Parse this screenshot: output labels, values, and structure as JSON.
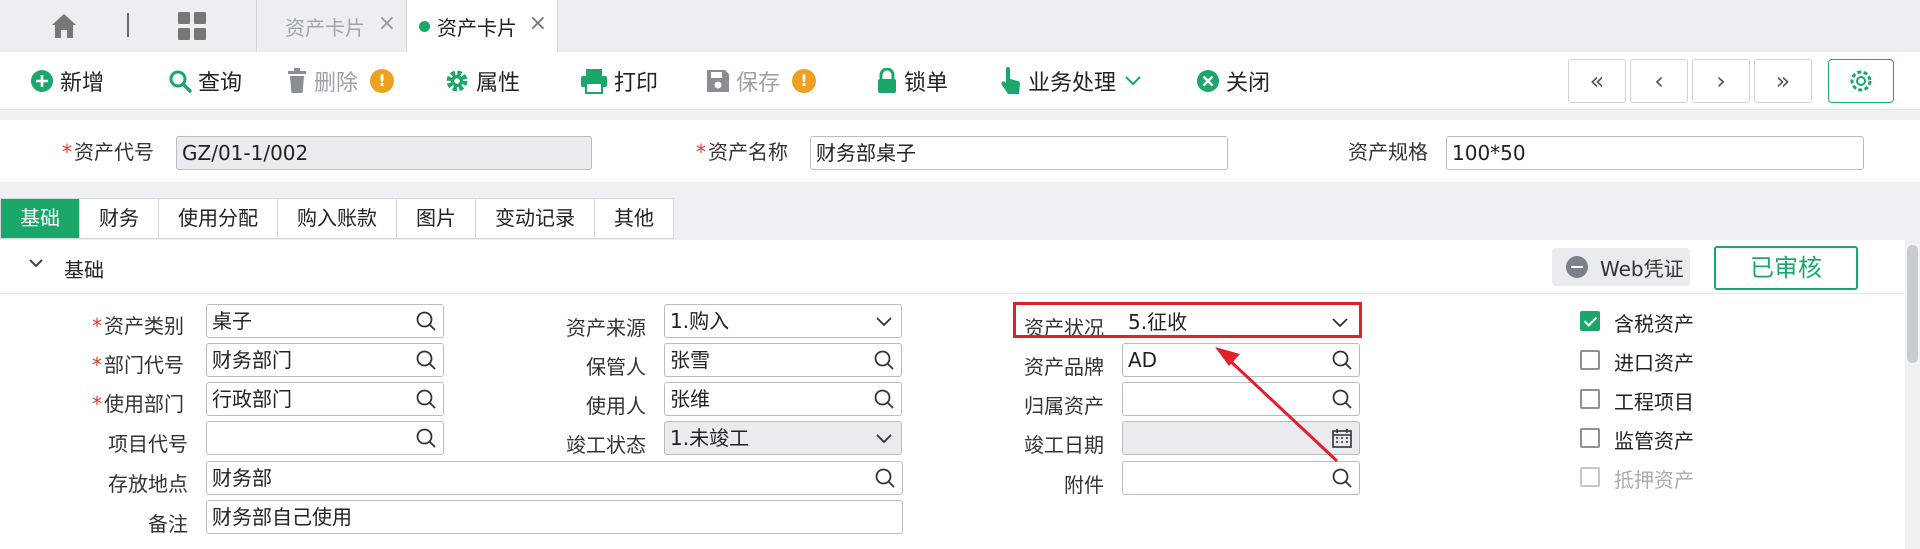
{
  "tabs": [
    {
      "label": "资产卡片",
      "active": false
    },
    {
      "label": "资产卡片",
      "active": true
    }
  ],
  "toolbar": {
    "add": "新增",
    "query": "查询",
    "delete": "删除",
    "properties": "属性",
    "print": "打印",
    "save": "保存",
    "lock": "锁单",
    "business": "业务处理",
    "close": "关闭",
    "warn_mark": "!"
  },
  "header": {
    "code_label": "资产代号",
    "code_value": "GZ/01-1/002",
    "name_label": "资产名称",
    "name_value": "财务部桌子",
    "spec_label": "资产规格",
    "spec_value": "100*50"
  },
  "section_tabs": [
    "基础",
    "财务",
    "使用分配",
    "购入账款",
    "图片",
    "变动记录",
    "其他"
  ],
  "section": {
    "title": "基础",
    "web_voucher": "Web凭证",
    "status_badge": "已审核"
  },
  "form": {
    "category_label": "资产类别",
    "category_value": "桌子",
    "dept_label": "部门代号",
    "dept_value": "财务部门",
    "use_dept_label": "使用部门",
    "use_dept_value": "行政部门",
    "project_label": "项目代号",
    "project_value": "",
    "location_label": "存放地点",
    "location_value": "财务部",
    "remark_label": "备注",
    "remark_value": "财务部自己使用",
    "source_label": "资产来源",
    "source_value": "1.购入",
    "keeper_label": "保管人",
    "keeper_value": "张雪",
    "user_label": "使用人",
    "user_value": "张维",
    "completion_label": "竣工状态",
    "completion_value": "1.未竣工",
    "status_label": "资产状况",
    "status_value": "5.征收",
    "brand_label": "资产品牌",
    "brand_value": "AD",
    "belong_label": "归属资产",
    "belong_value": "",
    "completion_date_label": "竣工日期",
    "completion_date_value": "",
    "attachment_label": "附件",
    "attachment_value": ""
  },
  "checkboxes": [
    {
      "label": "含税资产",
      "checked": true,
      "disabled": false
    },
    {
      "label": "进口资产",
      "checked": false,
      "disabled": false
    },
    {
      "label": "工程项目",
      "checked": false,
      "disabled": false
    },
    {
      "label": "监管资产",
      "checked": false,
      "disabled": false
    },
    {
      "label": "抵押资产",
      "checked": false,
      "disabled": true
    }
  ],
  "colors": {
    "accent": "#1aa86a",
    "warning": "#f0a020",
    "highlight": "#e0202a",
    "required": "#e0392b"
  }
}
